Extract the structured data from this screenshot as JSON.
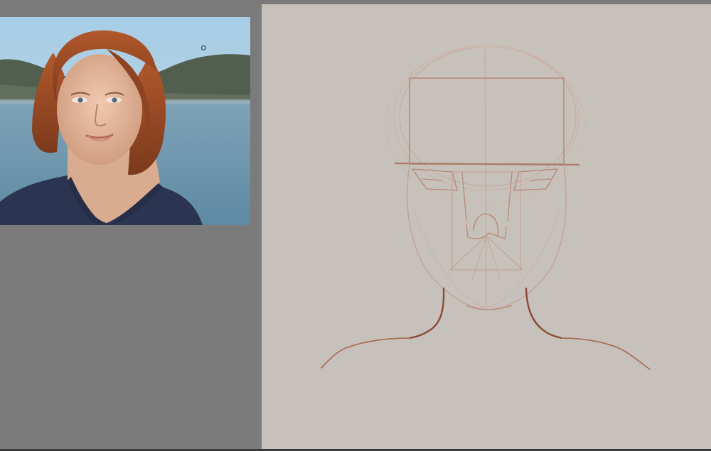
{
  "app": {
    "workspace_label": "",
    "reference_label": "",
    "canvas_label": ""
  },
  "colors": {
    "workspace_bg": "#7b7b7b",
    "canvas_bg": "#c7c1bc",
    "sketch_light": "#c4a294",
    "sketch_mid": "#b08672",
    "sketch_dark": "#8c4a33",
    "sky": "#a9cbe0",
    "water": "#6c93aa",
    "hill": "#4e5a4a",
    "hair": "#9a4a22",
    "skin": "#e1b59b",
    "sweater": "#2b3450"
  },
  "icons": {
    "cursor": "brush-cursor-icon"
  }
}
